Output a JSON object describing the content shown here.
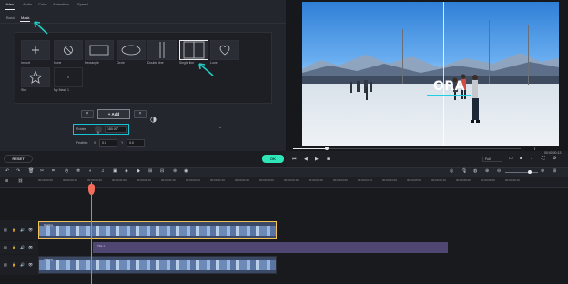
{
  "top_tabs": [
    "Video",
    "Audio",
    "Color",
    "Animation",
    "Speed"
  ],
  "sub_tabs": [
    "Basic",
    "Mask"
  ],
  "masks": [
    {
      "label": "Import",
      "icon": "plus-icon"
    },
    {
      "label": "None",
      "icon": "none-icon"
    },
    {
      "label": "Rectangle",
      "icon": "rectangle-icon"
    },
    {
      "label": "Circle",
      "icon": "circle-icon"
    },
    {
      "label": "Double line",
      "icon": "double-line-icon"
    },
    {
      "label": "Single line",
      "icon": "single-line-icon"
    },
    {
      "label": "Love",
      "icon": "heart-icon"
    },
    {
      "label": "Star",
      "icon": "star-icon"
    },
    {
      "label": "My Mask 1",
      "icon": "custom-mask-icon"
    }
  ],
  "selected_mask": "Single line",
  "controls": {
    "add_label": "+ Add",
    "rotate_label": "Rotate:",
    "rotate_value": "180.00°",
    "feather_label": "Feather:",
    "feather_x_label": "X",
    "feather_x_value": "0.0",
    "feather_y_label": "Y",
    "feather_y_value": "0.0",
    "reset_label": "RESET",
    "ok_label": "OK"
  },
  "preview": {
    "overlay_text": "ORA",
    "time_current": "00:00:00:13",
    "zoom": "Full"
  },
  "ruler_labels": [
    "00:00:00:00",
    "00:00:00:10",
    "00:00:00:20",
    "00:00:01:00",
    "00:00:01:10",
    "00:00:01:20",
    "00:00:02:00",
    "00:00:02:10",
    "00:00:02:20",
    "00:00:03:00",
    "00:00:03:10",
    "00:00:03:20",
    "00:00:04:00",
    "00:00:04:10",
    "00:00:04:20",
    "00:00:05:00",
    "00:00:05:10",
    "00:00:05:20",
    "00:00:06:00",
    "00:00:06:10"
  ],
  "clips": {
    "video1": "Skating",
    "title": "Title 1",
    "video2": "Skating"
  },
  "accent": {
    "cyan": "#14c3d5",
    "ok": "#2ee6b8",
    "playhead": "#f26d5b",
    "selected_clip": "#f3c25a"
  }
}
